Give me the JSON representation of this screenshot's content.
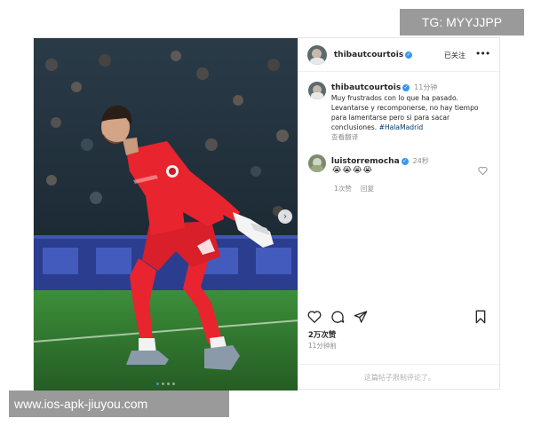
{
  "watermarks": {
    "top": "TG: MYYJJPP",
    "bottom": "www.ios-apk-jiuyou.com"
  },
  "header": {
    "username": "thibautcourtois",
    "follow_status": "已关注",
    "more_icon": "more-icon"
  },
  "caption": {
    "username": "thibautcourtois",
    "time": "11分钟",
    "text": "Muy frustrados con lo que ha pasado. Levantarse y recomponerse, no hay tiempo para lamentarse pero si para sacar conclusiones.",
    "hashtag": "#HalaMadrid",
    "translate_label": "查看翻译"
  },
  "comment": {
    "username": "luistorremocha",
    "time": "24秒",
    "text": "😭😭😭😭",
    "likes": "1次赞",
    "reply_label": "回复"
  },
  "actions": {
    "icons": [
      "heart-icon",
      "comment-icon",
      "share-icon",
      "bookmark-icon"
    ],
    "likes": "2万次赞",
    "posted_ago": "11分钟前"
  },
  "comments_disabled": "这篇帖子限制评论了。",
  "carousel": {
    "count": 4,
    "active_index": 0
  },
  "colors": {
    "verified": "#3897f0",
    "jersey": "#e8242f",
    "pitch": "#2f7d32"
  }
}
